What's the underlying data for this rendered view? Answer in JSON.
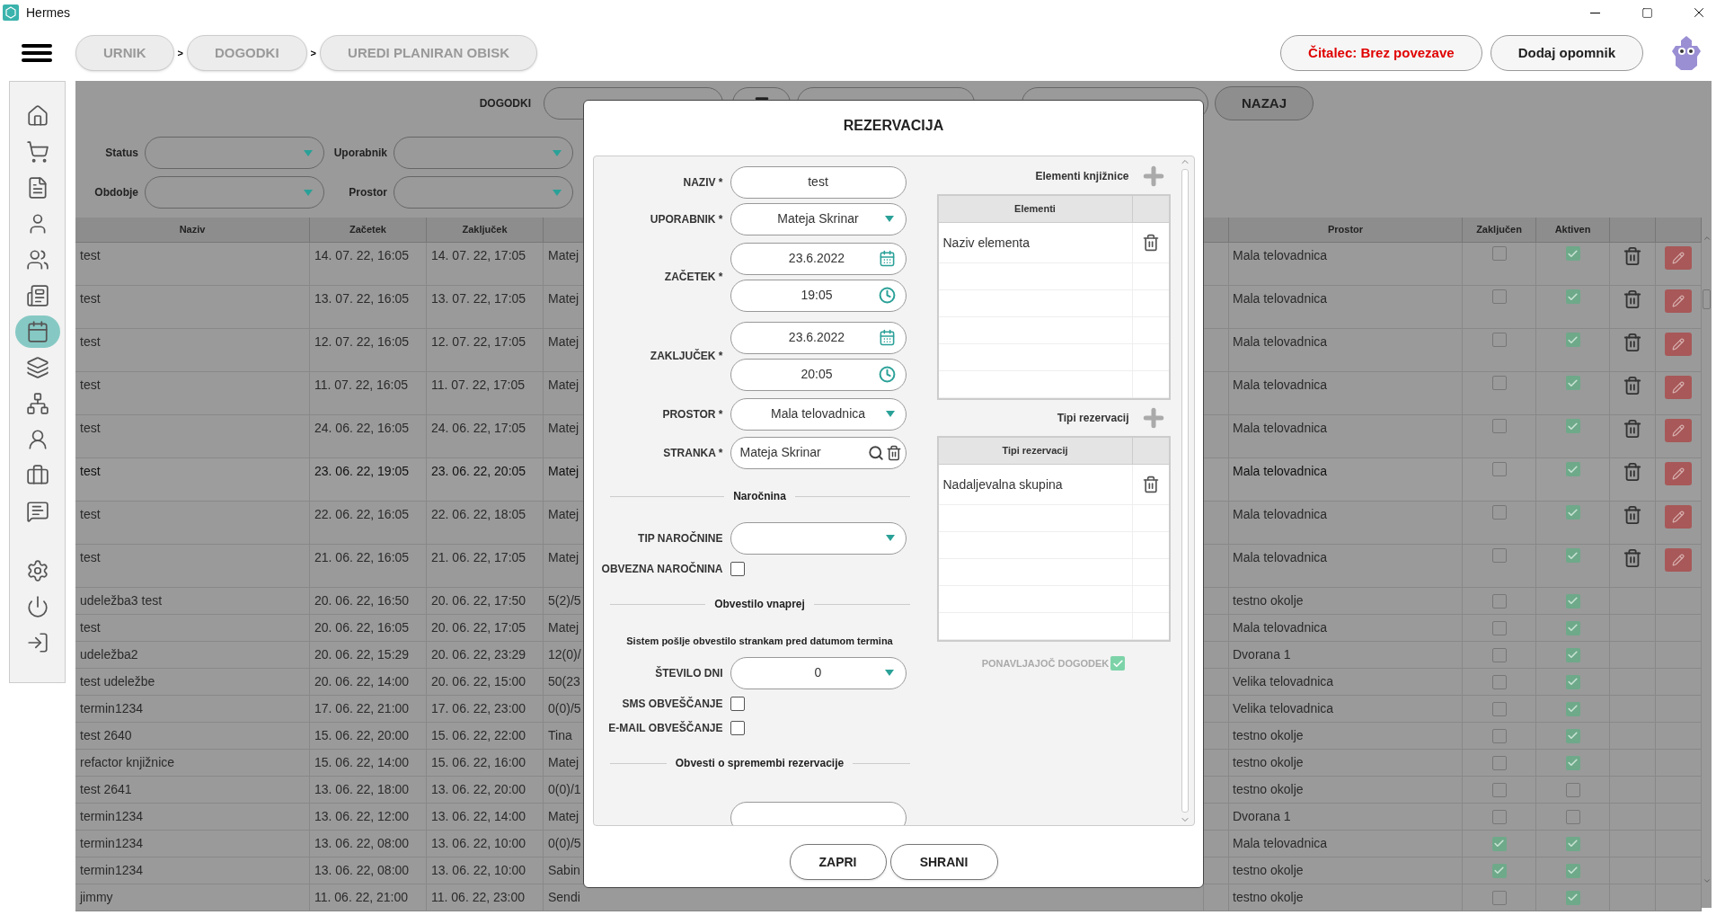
{
  "window": {
    "title": "Hermes"
  },
  "breadcrumbs": [
    {
      "label": "URNIK"
    },
    {
      "label": "DOGODKI"
    },
    {
      "label": "UREDI PLANIRAN OBISK"
    }
  ],
  "breadcrumb_separators": [
    ">",
    ">"
  ],
  "header_buttons": [
    {
      "label": "Čitalec: Brez povezave",
      "kind": "alert"
    },
    {
      "label": "Dodaj opomnik",
      "kind": "normal"
    }
  ],
  "sidebar": {
    "items": [
      {
        "selected": false
      },
      {
        "selected": false
      },
      {
        "selected": false
      },
      {
        "selected": false
      },
      {
        "selected": false
      },
      {
        "selected": false
      },
      {
        "selected": true
      },
      {
        "selected": false
      },
      {
        "selected": false
      },
      {
        "selected": false
      },
      {
        "selected": false
      },
      {
        "selected": false
      }
    ],
    "bottom_items": [
      {
        "selected": false
      },
      {
        "selected": false
      },
      {
        "selected": false
      }
    ]
  },
  "filters": {
    "search_label": "DOGODKI",
    "back_button": "NAZAJ",
    "dropdowns": [
      {
        "label": "Status"
      },
      {
        "label": "Uporabnik"
      },
      {
        "label": "Obdobje"
      },
      {
        "label": "Prostor"
      }
    ]
  },
  "table": {
    "columns": [
      "Naziv",
      "Začetek",
      "Zaključek",
      "Prostor",
      "Zaključen",
      "Aktiven"
    ],
    "rows": [
      {
        "naziv": "test",
        "zacetek": "14. 07. 22, 16:05",
        "zakljucek": "14. 07. 22, 17:05",
        "column_4": "Matej",
        "prostor": "Mala telovadnica",
        "zakljucen": false,
        "aktiven": true,
        "editable": true,
        "selected": false
      },
      {
        "naziv": "test",
        "zacetek": "13. 07. 22, 16:05",
        "zakljucek": "13. 07. 22, 17:05",
        "column_4": "Matej",
        "prostor": "Mala telovadnica",
        "zakljucen": false,
        "aktiven": true,
        "editable": true,
        "selected": false
      },
      {
        "naziv": "test",
        "zacetek": "12. 07. 22, 16:05",
        "zakljucek": "12. 07. 22, 17:05",
        "column_4": "Matej",
        "prostor": "Mala telovadnica",
        "zakljucen": false,
        "aktiven": true,
        "editable": true,
        "selected": false
      },
      {
        "naziv": "test",
        "zacetek": "11. 07. 22, 16:05",
        "zakljucek": "11. 07. 22, 17:05",
        "column_4": "Matej",
        "prostor": "Mala telovadnica",
        "zakljucen": false,
        "aktiven": true,
        "editable": true,
        "selected": false
      },
      {
        "naziv": "test",
        "zacetek": "24. 06. 22, 16:05",
        "zakljucek": "24. 06. 22, 17:05",
        "column_4": "Matej",
        "prostor": "Mala telovadnica",
        "zakljucen": false,
        "aktiven": true,
        "editable": true,
        "selected": false
      },
      {
        "naziv": "test",
        "zacetek": "23. 06. 22, 19:05",
        "zakljucek": "23. 06. 22, 20:05",
        "column_4": "Matej",
        "prostor": "Mala telovadnica",
        "zakljucen": false,
        "aktiven": true,
        "editable": true,
        "selected": true
      },
      {
        "naziv": "test",
        "zacetek": "22. 06. 22, 16:05",
        "zakljucek": "22. 06. 22, 18:05",
        "column_4": "Matej",
        "prostor": "Mala telovadnica",
        "zakljucen": false,
        "aktiven": true,
        "editable": true,
        "selected": false
      },
      {
        "naziv": "test",
        "zacetek": "21. 06. 22, 16:05",
        "zakljucek": "21. 06. 22, 17:05",
        "column_4": "Matej",
        "prostor": "Mala telovadnica",
        "zakljucen": false,
        "aktiven": true,
        "editable": true,
        "selected": false
      },
      {
        "naziv": "udeležba3 test",
        "zacetek": "20. 06. 22, 16:50",
        "zakljucek": "20. 06. 22, 17:50",
        "column_4": "5(2)/5",
        "prostor": "testno okolje",
        "zakljucen": false,
        "aktiven": true,
        "editable": false,
        "selected": false
      },
      {
        "naziv": "test",
        "zacetek": "20. 06. 22, 16:05",
        "zakljucek": "20. 06. 22, 17:05",
        "column_4": "Matej",
        "prostor": "Mala telovadnica",
        "zakljucen": false,
        "aktiven": true,
        "editable": false,
        "selected": false
      },
      {
        "naziv": "udeležba2",
        "zacetek": "20. 06. 22, 15:29",
        "zakljucek": "20. 06. 22, 23:29",
        "column_4": "12(0)/",
        "prostor": "Dvorana 1",
        "zakljucen": false,
        "aktiven": true,
        "editable": false,
        "selected": false
      },
      {
        "naziv": "test udeležbe",
        "zacetek": "20. 06. 22, 14:00",
        "zakljucek": "20. 06. 22, 15:00",
        "column_4": "50(23",
        "prostor": "Velika telovadnica",
        "zakljucen": false,
        "aktiven": true,
        "editable": false,
        "selected": false
      },
      {
        "naziv": "termin1234",
        "zacetek": "17. 06. 22, 21:00",
        "zakljucek": "17. 06. 22, 23:00",
        "column_4": "0(0)/5",
        "prostor": "Velika telovadnica",
        "zakljucen": false,
        "aktiven": true,
        "editable": false,
        "selected": false
      },
      {
        "naziv": "test 2640",
        "zacetek": "15. 06. 22, 20:00",
        "zakljucek": "15. 06. 22, 22:00",
        "column_4": "Tina",
        "prostor": "testno okolje",
        "zakljucen": false,
        "aktiven": true,
        "editable": false,
        "selected": false
      },
      {
        "naziv": "refactor knjižnice",
        "zacetek": "15. 06. 22, 14:00",
        "zakljucek": "15. 06. 22, 16:00",
        "column_4": "Matej",
        "prostor": "testno okolje",
        "zakljucen": false,
        "aktiven": true,
        "editable": false,
        "selected": false
      },
      {
        "naziv": "test 2641",
        "zacetek": "13. 06. 22, 18:00",
        "zakljucek": "13. 06. 22, 20:00",
        "column_4": "0(0)/1",
        "prostor": "testno okolje",
        "zakljucen": false,
        "aktiven": false,
        "editable": false,
        "selected": false
      },
      {
        "naziv": "termin1234",
        "zacetek": "13. 06. 22, 12:00",
        "zakljucek": "13. 06. 22, 14:00",
        "column_4": "Matej",
        "prostor": "Dvorana 1",
        "zakljucen": false,
        "aktiven": false,
        "editable": false,
        "selected": false
      },
      {
        "naziv": "termin1234",
        "zacetek": "13. 06. 22, 08:00",
        "zakljucek": "13. 06. 22, 10:00",
        "column_4": "0(0)/5",
        "prostor": "Mala telovadnica",
        "zakljucen": true,
        "aktiven": true,
        "editable": false,
        "selected": false
      },
      {
        "naziv": "termin1234",
        "zacetek": "13. 06. 22, 08:00",
        "zakljucek": "13. 06. 22, 10:00",
        "column_4": "Sabin",
        "prostor": "testno okolje",
        "zakljucen": true,
        "aktiven": true,
        "editable": false,
        "selected": false
      },
      {
        "naziv": "jimmy",
        "zacetek": "11. 06. 22, 21:00",
        "zakljucek": "11. 06. 22, 23:00",
        "column_4": "Sendi",
        "prostor": "testno okolje",
        "zakljucen": false,
        "aktiven": true,
        "editable": false,
        "selected": false
      }
    ]
  },
  "dialog": {
    "title": "REZERVACIJA",
    "fields": [
      {
        "kind": "text",
        "label": "NAZIV *",
        "value": "test"
      },
      {
        "kind": "select",
        "label": "UPORABNIK *",
        "value": "Mateja Skrinar"
      },
      {
        "kind": "datetime",
        "label": "ZAČETEK *",
        "date": "23.6.2022",
        "time": "19:05"
      },
      {
        "kind": "datetime",
        "label": "ZAKLJUČEK *",
        "date": "23.6.2022",
        "time": "20:05"
      },
      {
        "kind": "select",
        "label": "PROSTOR *",
        "value": "Mala telovadnica"
      },
      {
        "kind": "search",
        "label": "STRANKA *",
        "value": "Mateja Skrinar"
      },
      {
        "kind": "section",
        "label": "Naročnina"
      },
      {
        "kind": "select",
        "label": "TIP NAROČNINE"
      },
      {
        "kind": "checkbox",
        "label": "OBVEZNA NAROČNINA",
        "checked": false
      },
      {
        "kind": "section",
        "label": "Obvestilo vnaprej"
      },
      {
        "kind": "note",
        "label": "Sistem pošlje obvestilo strankam pred datumom termina"
      },
      {
        "kind": "select",
        "label": "ŠTEVILO DNI",
        "value": "0"
      },
      {
        "kind": "checkbox",
        "label": "SMS OBVEŠČANJE",
        "checked": false
      },
      {
        "kind": "checkbox",
        "label": "E-MAIL OBVEŠČANJE",
        "checked": false
      },
      {
        "kind": "section",
        "label": "Obvesti o spremembi rezervacije"
      },
      {
        "kind": "partial"
      }
    ],
    "lists": [
      {
        "title": "Elementi knjižnice",
        "header": "Elementi",
        "items": [
          "Naziv elementa"
        ]
      },
      {
        "title": "Tipi rezervacij",
        "header": "Tipi rezervacij",
        "items": [
          "Nadaljevalna skupina"
        ]
      }
    ],
    "repeating": {
      "label": "PONAVLJAJOČ DOGODEK",
      "checked": true
    },
    "buttons": [
      "ZAPRI",
      "SHRANI"
    ]
  }
}
